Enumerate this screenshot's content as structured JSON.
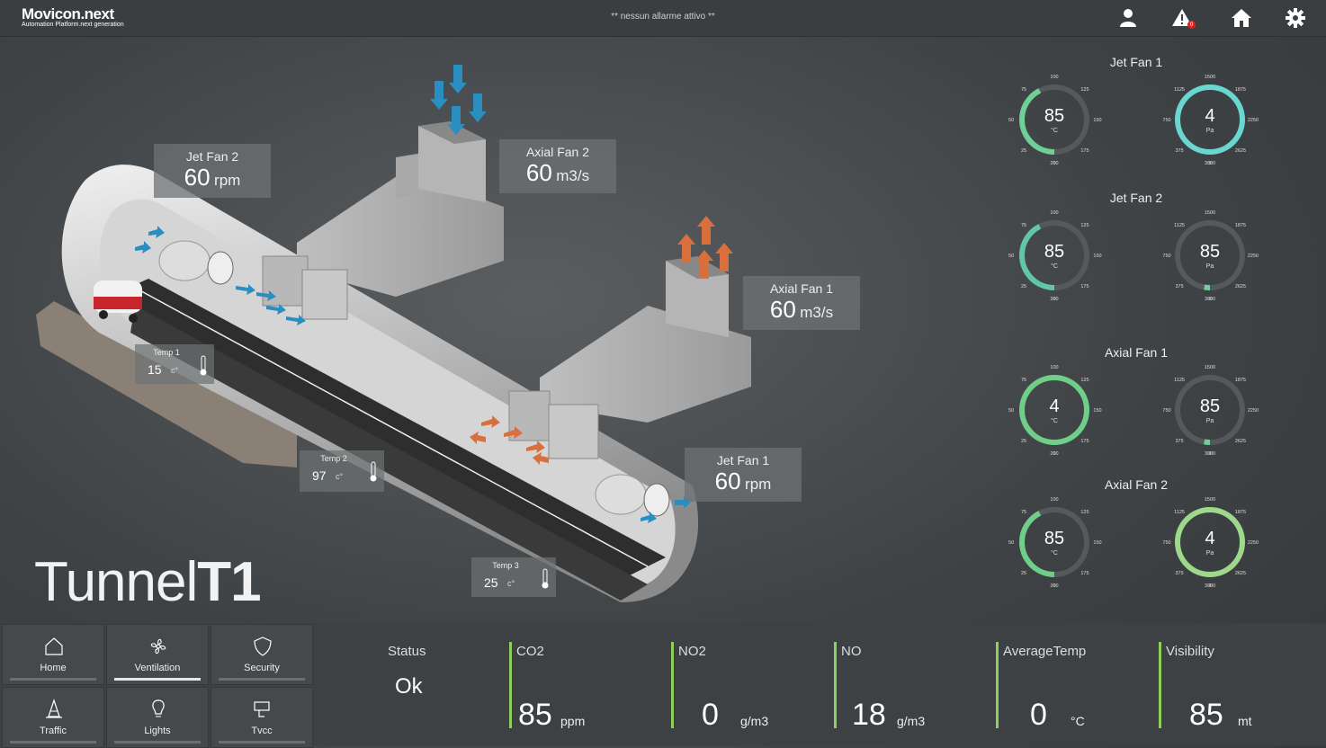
{
  "header": {
    "brand": "Movicon.next",
    "tagline": "Automation Platform.next generation",
    "alarm_text": "** nessun allarme attivo **",
    "alarm_badge": "0",
    "icons": [
      "user-icon",
      "alarm-icon",
      "home-icon",
      "gear-icon"
    ]
  },
  "scene": {
    "title_light": "Tunnel",
    "title_bold": "T1",
    "fans": [
      {
        "name": "Jet Fan 2",
        "value": "60",
        "unit": "rpm"
      },
      {
        "name": "Axial Fan 2",
        "value": "60",
        "unit": "m3/s"
      },
      {
        "name": "Axial Fan 1",
        "value": "60",
        "unit": "m3/s"
      },
      {
        "name": "Jet Fan 1",
        "value": "60",
        "unit": "rpm"
      }
    ],
    "temps": [
      {
        "name": "Temp 1",
        "value": "15",
        "unit": "c°"
      },
      {
        "name": "Temp 2",
        "value": "97",
        "unit": "c°"
      },
      {
        "name": "Temp 3",
        "value": "25",
        "unit": "c°"
      }
    ],
    "colors": {
      "intake": "#2a8fc0",
      "exhaust": "#d86f3c",
      "van": "#c8262c"
    }
  },
  "gauges": {
    "temp_ticks": [
      "0",
      "25",
      "50",
      "75",
      "100",
      "125",
      "150",
      "175",
      "200"
    ],
    "pressure_ticks": [
      "0",
      "375",
      "750",
      "1125",
      "1500",
      "1875",
      "2250",
      "2625",
      "3000"
    ],
    "groups": [
      {
        "title": "Jet Fan 1",
        "temp": {
          "value": "85",
          "unit": "°C",
          "fraction": 0.425,
          "color": "#6fcf97"
        },
        "pressure": {
          "value": "4",
          "unit": "Pa",
          "fraction": 1.0,
          "color": "#69d6cf"
        }
      },
      {
        "title": "Jet Fan 2",
        "temp": {
          "value": "85",
          "unit": "°C",
          "fraction": 0.425,
          "color": "#5fc7a8"
        },
        "pressure": {
          "value": "85",
          "unit": "Pa",
          "fraction": 0.028,
          "color": "#6fcf97"
        }
      },
      {
        "title": "Axial Fan 1",
        "temp": {
          "value": "4",
          "unit": "°C",
          "fraction": 1.0,
          "color": "#6fcf88"
        },
        "pressure": {
          "value": "85",
          "unit": "Pa",
          "fraction": 0.028,
          "color": "#6fcf97"
        }
      },
      {
        "title": "Axial Fan 2",
        "temp": {
          "value": "85",
          "unit": "°C",
          "fraction": 0.425,
          "color": "#6fcf88"
        },
        "pressure": {
          "value": "4",
          "unit": "Pa",
          "fraction": 1.0,
          "color": "#9ed88a"
        }
      }
    ]
  },
  "nav": [
    {
      "label": "Home",
      "icon": "home-icon",
      "active": false
    },
    {
      "label": "Ventilation",
      "icon": "fan-icon",
      "active": true
    },
    {
      "label": "Security",
      "icon": "shield-icon",
      "active": false
    },
    {
      "label": "Traffic",
      "icon": "traffic-cone-icon",
      "active": false
    },
    {
      "label": "Lights",
      "icon": "lightbulb-icon",
      "active": false
    },
    {
      "label": "Tvcc",
      "icon": "camera-icon",
      "active": false
    }
  ],
  "status": {
    "label": "Status",
    "value": "Ok"
  },
  "kpis": [
    {
      "label": "CO2",
      "value": "85",
      "unit": "ppm"
    },
    {
      "label": "NO2",
      "value": "0",
      "unit": "g/m3"
    },
    {
      "label": "NO",
      "value": "18",
      "unit": "g/m3"
    },
    {
      "label": "AverageTemp",
      "value": "0",
      "unit": "°C"
    },
    {
      "label": "Visibility",
      "value": "85",
      "unit": "mt"
    }
  ]
}
